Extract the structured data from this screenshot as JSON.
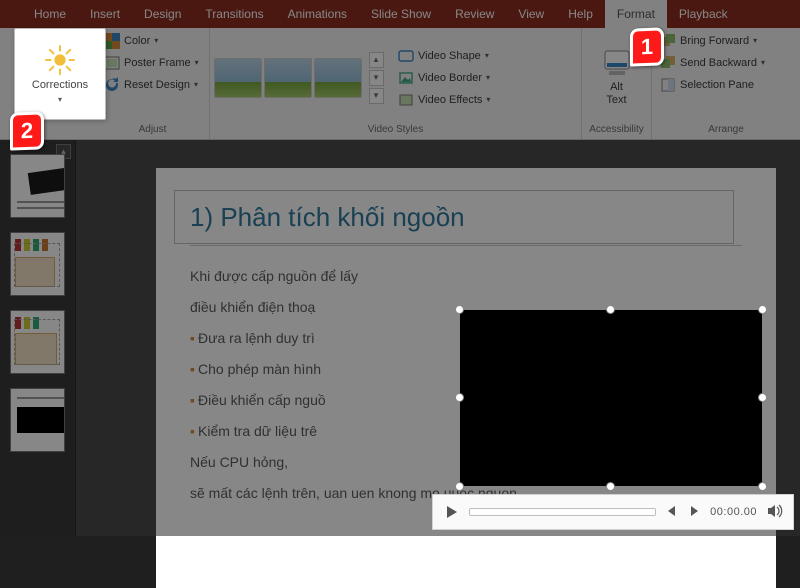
{
  "tabs": [
    "Home",
    "Insert",
    "Design",
    "Transitions",
    "Animations",
    "Slide Show",
    "Review",
    "View",
    "Help",
    "Format",
    "Playback"
  ],
  "activeTab": "Format",
  "ribbon": {
    "adjust": {
      "corrections": "Corrections",
      "color": "Color",
      "posterFrame": "Poster Frame",
      "resetDesign": "Reset Design",
      "groupLabel": "Adjust"
    },
    "videoStyles": {
      "shape": "Video Shape",
      "border": "Video Border",
      "effects": "Video Effects",
      "groupLabel": "Video Styles"
    },
    "accessibility": {
      "altText": "Alt\nText",
      "groupLabel": "Accessibility"
    },
    "arrange": {
      "bringForward": "Bring Forward",
      "sendBackward": "Send Backward",
      "selectionPane": "Selection Pane",
      "groupLabel": "Arrange"
    }
  },
  "popout": {
    "label": "Corrections"
  },
  "callouts": {
    "one": "1",
    "two": "2"
  },
  "slide": {
    "title": "1) Phân tích khối ngoồn",
    "p1": "Khi được cấp nguồn                                                       để lấy",
    "p1b": "điều khiển điện thoạ",
    "b1": "Đưa ra lệnh duy trì",
    "b2": "Cho phép màn hình",
    "b3": "Điều khiển cấp nguồ",
    "b4": "Kiểm tra dữ liệu trê",
    "p2": "Nếu CPU hỏng,",
    "p2b": "sẽ mất các lệnh trên, uan uen knong mo uuọc nguon."
  },
  "player": {
    "time": "00:00.00"
  }
}
